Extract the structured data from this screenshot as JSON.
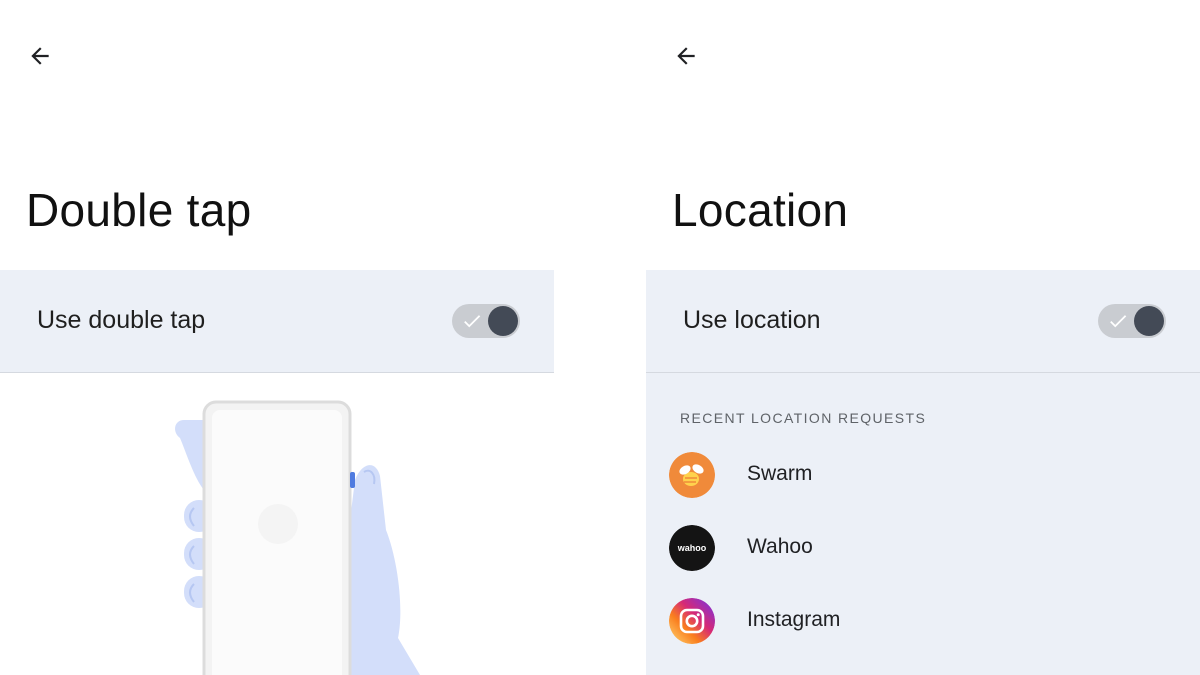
{
  "left_panel": {
    "title": "Double tap",
    "toggle": {
      "label": "Use double tap",
      "on": true
    }
  },
  "right_panel": {
    "title": "Location",
    "toggle": {
      "label": "Use location",
      "on": true
    },
    "recent": {
      "header": "RECENT LOCATION REQUESTS",
      "apps": [
        {
          "name": "Swarm",
          "icon": "swarm-icon",
          "color": "#f08a3a"
        },
        {
          "name": "Wahoo",
          "icon": "wahoo-icon",
          "color": "#141414",
          "logo_text": "wahoo"
        },
        {
          "name": "Instagram",
          "icon": "instagram-icon",
          "color": "#d6249f"
        }
      ]
    }
  },
  "colors": {
    "row_background": "#ecf0f7",
    "switch_track": "#c9ccd1",
    "switch_knob": "#434a56",
    "illustration_blue": "#d3defa"
  }
}
